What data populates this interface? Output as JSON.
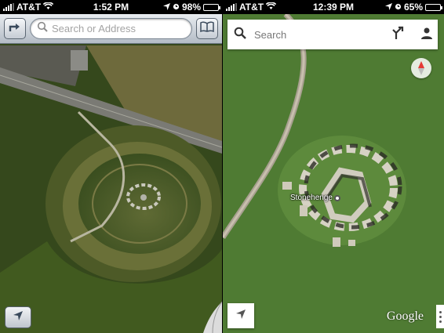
{
  "left": {
    "status": {
      "carrier": "AT&T",
      "time": "1:52 PM",
      "battery": "98%",
      "battery_level": 0.98
    },
    "toolbar": {
      "search_placeholder": "Search or Address"
    },
    "icons": [
      "directions-icon",
      "bookmarks-icon",
      "location-arrow-icon",
      "page-curl-icon"
    ]
  },
  "right": {
    "status": {
      "carrier": "AT&T",
      "time": "12:39 PM",
      "battery": "65%",
      "battery_level": 0.65
    },
    "search": {
      "placeholder": "Search"
    },
    "place_label": "Stonehenge",
    "logo": "Google",
    "icons": [
      "search-icon",
      "directions-icon",
      "account-icon",
      "compass-icon",
      "location-arrow-icon",
      "more-icon"
    ]
  },
  "colors": {
    "ios_bar": "#c6ccd4",
    "google_bar": "#ffffff",
    "grass": "#4f7a2f"
  }
}
